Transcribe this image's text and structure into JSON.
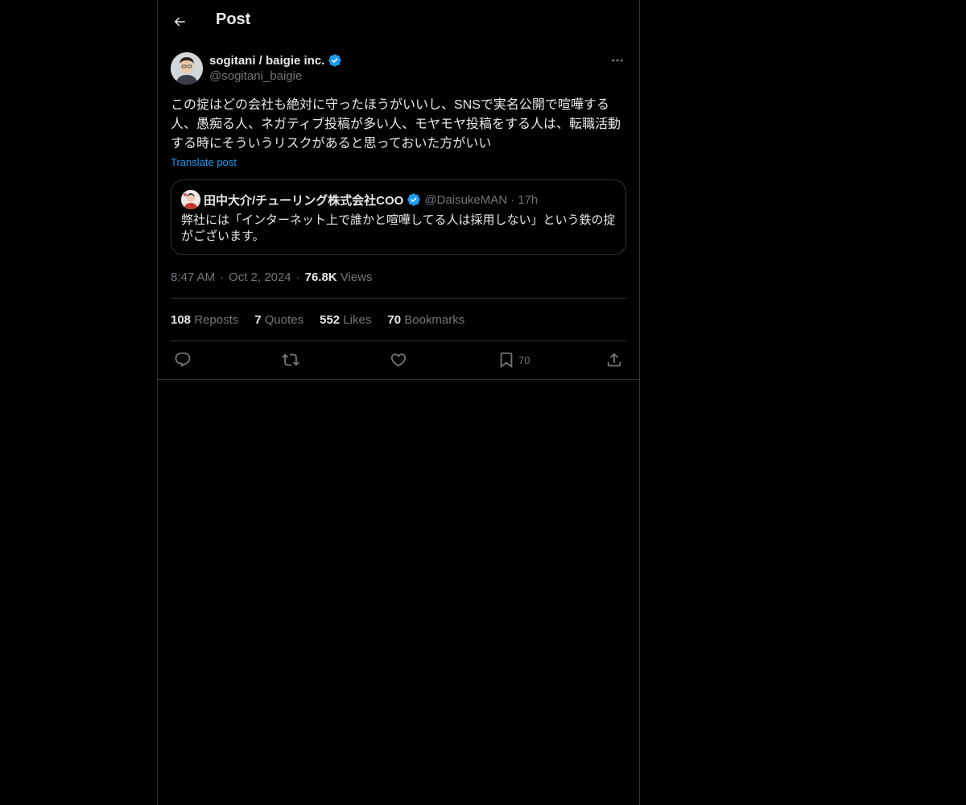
{
  "header": {
    "back_icon": "arrow-left-icon",
    "title": "Post"
  },
  "author": {
    "name": "sogitani / baigie inc.",
    "handle": "@sogitani_baigie",
    "verified": true,
    "verified_color": "#1d9bf0"
  },
  "post": {
    "text": "この掟はどの会社も絶対に守ったほうがいいし、SNSで実名公開で喧嘩する人、愚痴る人、ネガティブ投稿が多い人、モヤモヤ投稿をする人は、転職活動する時にそういうリスクがあると思っておいた方がいい",
    "translate_label": "Translate post"
  },
  "quote": {
    "name": "田中大介/チューリング株式会社COO",
    "handle": "@DaisukeMAN",
    "separator": "·",
    "time": "17h",
    "text": "弊社には「インターネット上で誰かと喧嘩してる人は採用しない」という鉄の掟がございます。"
  },
  "meta": {
    "time": "8:47 AM",
    "separator": "·",
    "date": "Oct 2, 2024",
    "views_count": "76.8K",
    "views_label": "Views"
  },
  "stats": {
    "reposts_count": "108",
    "reposts_label": "Reposts",
    "quotes_count": "7",
    "quotes_label": "Quotes",
    "likes_count": "552",
    "likes_label": "Likes",
    "bookmarks_count": "70",
    "bookmarks_label": "Bookmarks"
  },
  "actions": {
    "reply_icon": "reply-icon",
    "repost_icon": "repost-icon",
    "like_icon": "heart-icon",
    "bookmark_icon": "bookmark-icon",
    "bookmark_count": "70",
    "share_icon": "share-icon"
  },
  "colors": {
    "background": "#000000",
    "text_primary": "#e7e9ea",
    "text_secondary": "#71767b",
    "border": "#2f3336",
    "accent": "#1d9bf0"
  }
}
